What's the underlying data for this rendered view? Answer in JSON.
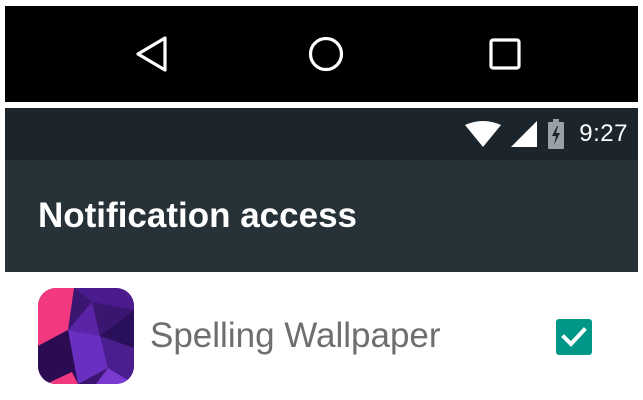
{
  "navigation_bar": {
    "buttons": [
      {
        "icon": "back-triangle-icon"
      },
      {
        "icon": "home-circle-icon"
      },
      {
        "icon": "recents-square-icon"
      }
    ]
  },
  "status_bar": {
    "icons": [
      "wifi-icon",
      "cell-signal-icon",
      "battery-charging-icon"
    ],
    "time": "9:27"
  },
  "toolbar": {
    "title": "Notification access"
  },
  "app_list": [
    {
      "label": "Spelling Wallpaper",
      "icon": "spelling-wallpaper-app-icon",
      "checked": true
    }
  ],
  "colors": {
    "status_bar": "#1b252b",
    "toolbar": "#263238",
    "accent": "#009688",
    "label_text": "#6e6e6e"
  }
}
